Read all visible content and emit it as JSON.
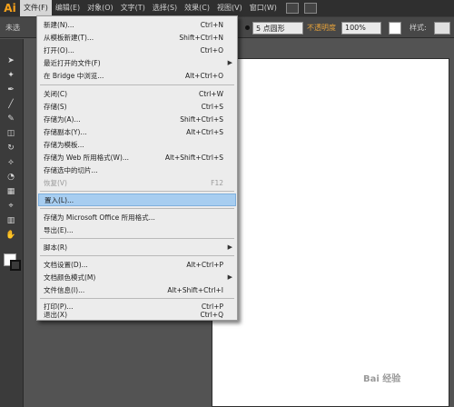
{
  "menubar": {
    "logo": "Ai",
    "items": [
      {
        "label": "文件(F)",
        "active": true
      },
      {
        "label": "编辑(E)"
      },
      {
        "label": "对象(O)"
      },
      {
        "label": "文字(T)"
      },
      {
        "label": "选择(S)"
      },
      {
        "label": "效果(C)"
      },
      {
        "label": "视图(V)"
      },
      {
        "label": "窗口(W)"
      }
    ]
  },
  "controlbar": {
    "selection_label": "未选",
    "brush_value": "5 点圆形",
    "opacity_label": "不透明度",
    "opacity_value": "100%",
    "style_label": "样式:",
    "accent_color": "#e8a33a"
  },
  "file_menu": {
    "items": [
      {
        "label": "新建(N)...",
        "shortcut": "Ctrl+N"
      },
      {
        "label": "从模板新建(T)...",
        "shortcut": "Shift+Ctrl+N"
      },
      {
        "label": "打开(O)...",
        "shortcut": "Ctrl+O"
      },
      {
        "label": "最近打开的文件(F)",
        "shortcut": "",
        "submenu": true
      },
      {
        "label": "在 Bridge 中浏览...",
        "shortcut": "Alt+Ctrl+O"
      },
      {
        "label": "关闭(C)",
        "shortcut": "Ctrl+W"
      },
      {
        "label": "存储(S)",
        "shortcut": "Ctrl+S"
      },
      {
        "label": "存储为(A)...",
        "shortcut": "Shift+Ctrl+S"
      },
      {
        "label": "存储副本(Y)...",
        "shortcut": "Alt+Ctrl+S"
      },
      {
        "label": "存储为模板...",
        "shortcut": ""
      },
      {
        "label": "存储为 Web 所用格式(W)...",
        "shortcut": "Alt+Shift+Ctrl+S"
      },
      {
        "label": "存储选中的切片...",
        "shortcut": ""
      },
      {
        "label": "恢复(V)",
        "shortcut": "F12",
        "disabled": true
      },
      {
        "label": "置入(L)...",
        "shortcut": "",
        "highlighted": true
      },
      {
        "label": "存储为 Microsoft Office 所用格式...",
        "shortcut": ""
      },
      {
        "label": "导出(E)...",
        "shortcut": ""
      },
      {
        "label": "脚本(R)",
        "shortcut": "",
        "submenu": true
      },
      {
        "label": "文档设置(D)...",
        "shortcut": "Alt+Ctrl+P"
      },
      {
        "label": "文档颜色模式(M)",
        "shortcut": "",
        "submenu": true
      },
      {
        "label": "文件信息(I)...",
        "shortcut": "Alt+Shift+Ctrl+I"
      },
      {
        "label": "打印(P)...",
        "shortcut": "Ctrl+P"
      },
      {
        "label": "退出(X)",
        "shortcut": "Ctrl+Q"
      }
    ]
  },
  "watermark": "Bai 经验"
}
